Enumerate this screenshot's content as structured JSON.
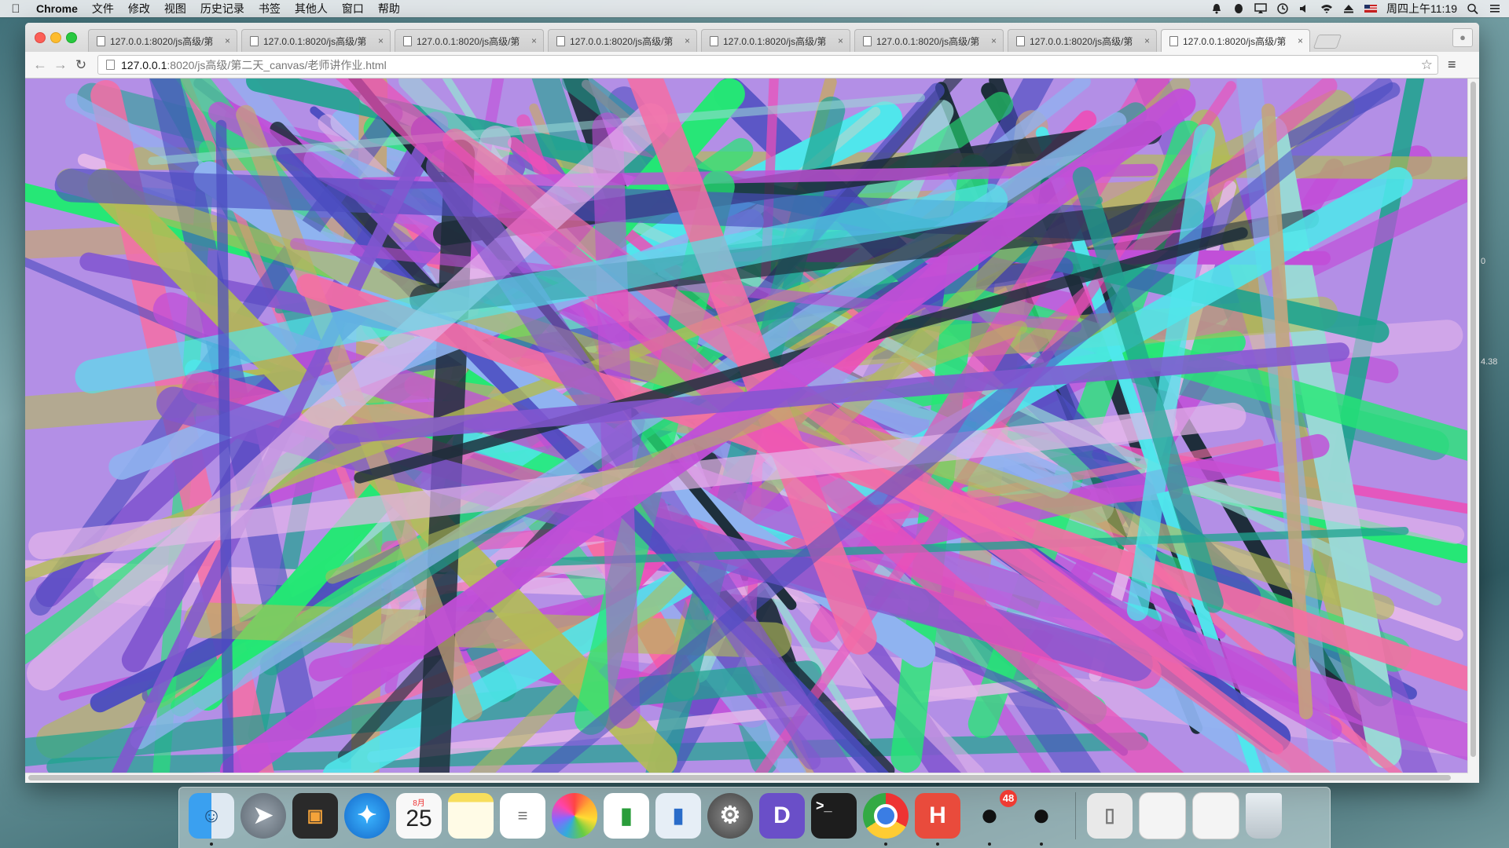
{
  "menubar": {
    "app_name": "Chrome",
    "items": [
      "文件",
      "修改",
      "视图",
      "历史记录",
      "书签",
      "其他人",
      "窗口",
      "帮助"
    ],
    "clock": "周四上午11:19",
    "status_icons": [
      "notification-icon",
      "qq-status-icon",
      "screen-mirror-icon",
      "time-machine-icon",
      "volume-icon",
      "wifi-icon",
      "eject-icon",
      "flag-us-icon",
      "search-icon",
      "list-icon"
    ]
  },
  "browser": {
    "tabs": [
      {
        "title": "127.0.0.1:8020/js高级/第",
        "active": false
      },
      {
        "title": "127.0.0.1:8020/js高级/第",
        "active": false
      },
      {
        "title": "127.0.0.1:8020/js高级/第",
        "active": false
      },
      {
        "title": "127.0.0.1:8020/js高级/第",
        "active": false
      },
      {
        "title": "127.0.0.1:8020/js高级/第",
        "active": false
      },
      {
        "title": "127.0.0.1:8020/js高级/第",
        "active": false
      },
      {
        "title": "127.0.0.1:8020/js高级/第",
        "active": false
      },
      {
        "title": "127.0.0.1:8020/js高级/第",
        "active": true
      }
    ],
    "tab_close_glyph": "×",
    "url_host": "127.0.0.1",
    "url_path": ":8020/js高级/第二天_canvas/老师讲作业.html",
    "back_glyph": "←",
    "forward_glyph": "→",
    "reload_glyph": "↻",
    "star_glyph": "☆",
    "menu_glyph": "≡"
  },
  "side_peek": [
    "0",
    "4.38"
  ],
  "canvas": {
    "description_colors": [
      "#c14fd8",
      "#8fb3f0",
      "#ec4fb8",
      "#1fa38f",
      "#24e874",
      "#4b4cc0",
      "#1c2c38",
      "#c4a577",
      "#f56ea4",
      "#9ad9d6",
      "#e4b6ea",
      "#8256d0",
      "#4fe7ec",
      "#b2bb55"
    ]
  },
  "dock": {
    "items": [
      {
        "name": "finder-icon",
        "label": "Finder",
        "running": true
      },
      {
        "name": "launchpad-icon",
        "label": "Launchpad",
        "running": false
      },
      {
        "name": "photo-booth-icon",
        "label": "Photo",
        "running": false
      },
      {
        "name": "safari-icon",
        "label": "Safari",
        "running": false
      },
      {
        "name": "calendar-icon",
        "label": "Calendar",
        "running": false,
        "month": "8月",
        "day": "25"
      },
      {
        "name": "notes-icon",
        "label": "Notes",
        "running": false
      },
      {
        "name": "reminders-icon",
        "label": "Reminders",
        "running": false
      },
      {
        "name": "photos-icon",
        "label": "Photos",
        "running": false
      },
      {
        "name": "numbers-icon",
        "label": "Numbers",
        "running": false
      },
      {
        "name": "keynote-icon",
        "label": "Keynote",
        "running": false
      },
      {
        "name": "system-preferences-icon",
        "label": "System Preferences",
        "running": false
      },
      {
        "name": "dash-icon",
        "label": "D",
        "running": false
      },
      {
        "name": "terminal-icon",
        "label": ">_",
        "running": false
      },
      {
        "name": "chrome-icon",
        "label": "Chrome",
        "running": true
      },
      {
        "name": "hbuilder-icon",
        "label": "H",
        "running": true
      },
      {
        "name": "qq-icon",
        "label": "QQ",
        "running": true,
        "badge": "48"
      },
      {
        "name": "qq-icon-2",
        "label": "QQ",
        "running": true
      }
    ],
    "stacks": [
      "downloads-stack-icon",
      "screenshot-stack-icon",
      "screenshot-stack-icon-2",
      "trash-icon"
    ]
  }
}
